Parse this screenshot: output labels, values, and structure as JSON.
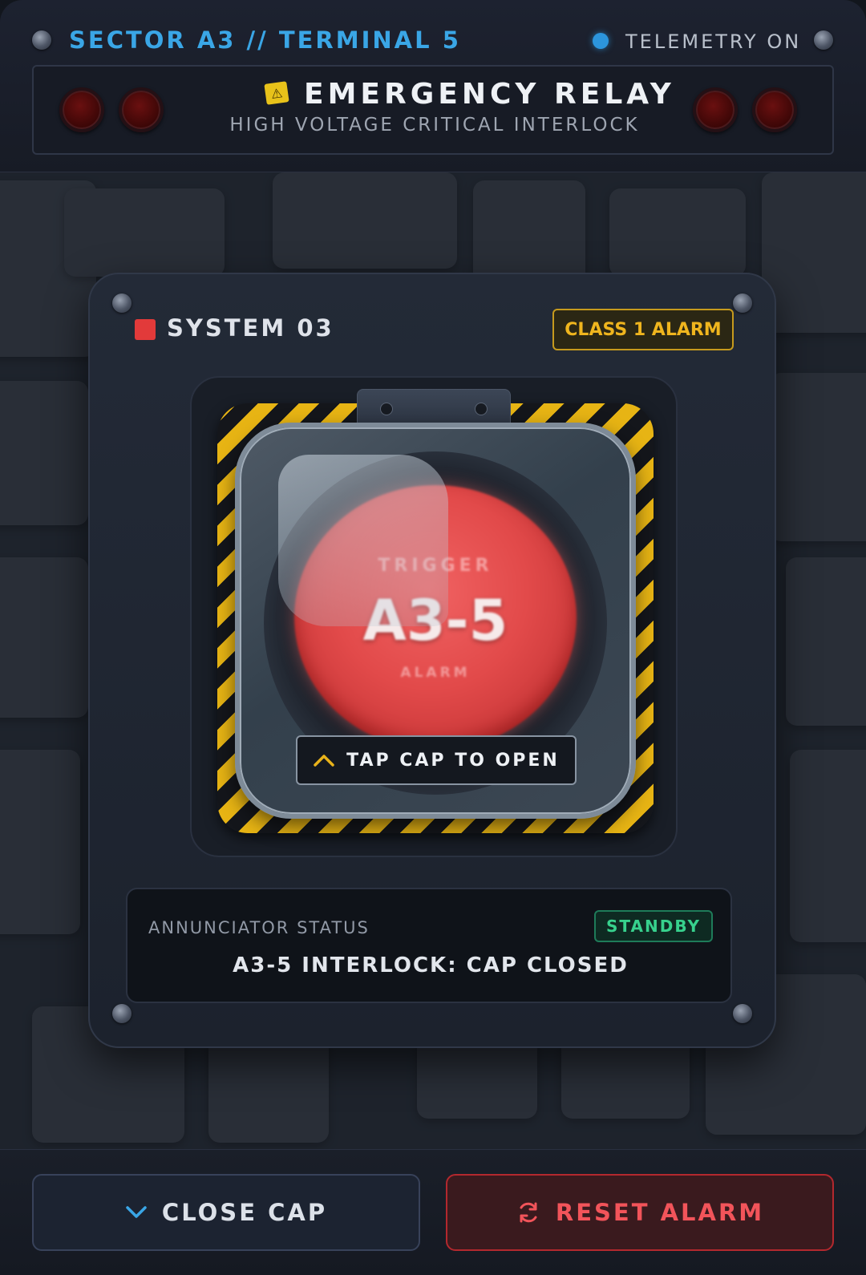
{
  "header": {
    "sector_label": "SECTOR A3 // TERMINAL 5",
    "telemetry_label": "TELEMETRY ON",
    "title": "EMERGENCY RELAY",
    "subtitle": "HIGH VOLTAGE CRITICAL INTERLOCK",
    "warning_icon": "warning-sticker-icon"
  },
  "panel": {
    "system_label": "SYSTEM 03",
    "alarm_class": "CLASS 1 ALARM",
    "button": {
      "top_text": "TRIGGER",
      "code": "A3-5",
      "bottom_text": "ALARM"
    },
    "tap_label": "TAP CAP TO OPEN",
    "status": {
      "caption": "ANNUNCIATOR STATUS",
      "badge": "STANDBY",
      "message": "A3-5 INTERLOCK: CAP CLOSED"
    }
  },
  "footer": {
    "close_label": "CLOSE CAP",
    "reset_label": "RESET ALARM"
  },
  "colors": {
    "accent_blue": "#3aa6e6",
    "alarm_amber": "#efb51e",
    "button_red": "#e24a4a",
    "standby_green": "#37d18d",
    "reset_red": "#f2545a"
  }
}
